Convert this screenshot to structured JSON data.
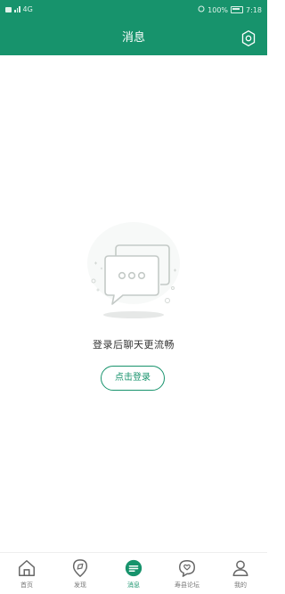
{
  "status_bar": {
    "left_text": "4G",
    "right_text": "100%",
    "time": "7:18"
  },
  "header": {
    "title": "消息"
  },
  "empty_state": {
    "message": "登录后聊天更流畅",
    "login_label": "点击登录"
  },
  "tabs": [
    {
      "label": "首页",
      "icon": "home-icon"
    },
    {
      "label": "发现",
      "icon": "discover-icon"
    },
    {
      "label": "消息",
      "icon": "message-icon"
    },
    {
      "label": "寿县论坛",
      "icon": "forum-icon"
    },
    {
      "label": "我的",
      "icon": "profile-icon"
    }
  ],
  "colors": {
    "brand": "#17936c",
    "background": "#ffffff",
    "text": "#333333",
    "inactive": "#777777"
  }
}
